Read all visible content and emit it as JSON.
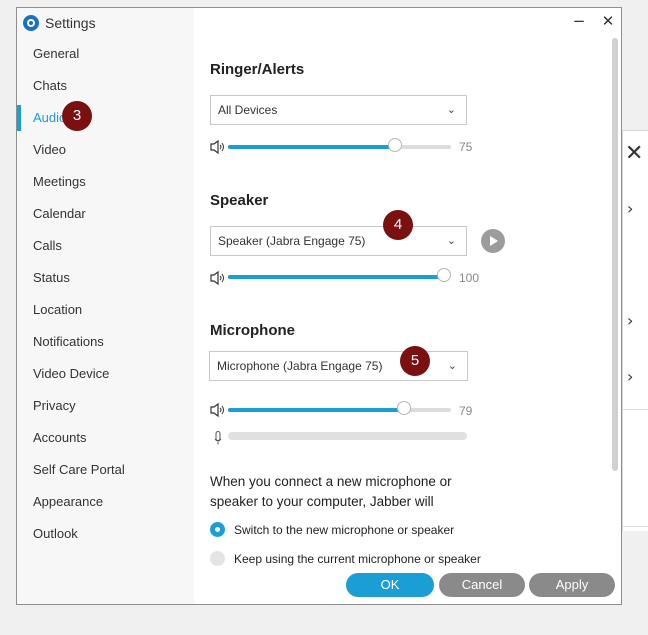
{
  "window": {
    "title": "Settings",
    "minimize_glyph": "−",
    "close_glyph": "✕"
  },
  "sidebar": {
    "items": [
      {
        "label": "General"
      },
      {
        "label": "Chats"
      },
      {
        "label": "Audio"
      },
      {
        "label": "Video"
      },
      {
        "label": "Meetings"
      },
      {
        "label": "Calendar"
      },
      {
        "label": "Calls"
      },
      {
        "label": "Status"
      },
      {
        "label": "Location"
      },
      {
        "label": "Notifications"
      },
      {
        "label": "Video Device"
      },
      {
        "label": "Privacy"
      },
      {
        "label": "Accounts"
      },
      {
        "label": "Self Care Portal"
      },
      {
        "label": "Appearance"
      },
      {
        "label": "Outlook"
      }
    ],
    "active_item": "Audio"
  },
  "ringer": {
    "heading": "Ringer/Alerts",
    "device": "All Devices",
    "volume": 75,
    "volume_label": "75"
  },
  "speaker": {
    "heading": "Speaker",
    "device": "Speaker (Jabra Engage 75)",
    "volume": 100,
    "volume_label": "100"
  },
  "microphone": {
    "heading": "Microphone",
    "device": "Microphone (Jabra Engage 75)",
    "volume": 79,
    "volume_label": "79",
    "input_level": 0
  },
  "new_device": {
    "description": "When you connect a new microphone or speaker to your computer, Jabber will",
    "options": [
      {
        "label": "Switch to the new microphone or speaker",
        "selected": true
      },
      {
        "label": "Keep using the current microphone or speaker",
        "selected": false
      }
    ]
  },
  "buttons": {
    "ok": "OK",
    "cancel": "Cancel",
    "apply": "Apply"
  },
  "annotations": {
    "audio": "3",
    "speaker": "4",
    "microphone": "5"
  },
  "background_window": {
    "close_glyph": "✕",
    "chevron_glyph": "›"
  },
  "colors": {
    "accent": "#1a9ed4",
    "annotation": "#7a1010",
    "button_gray": "#8a8a8a"
  }
}
